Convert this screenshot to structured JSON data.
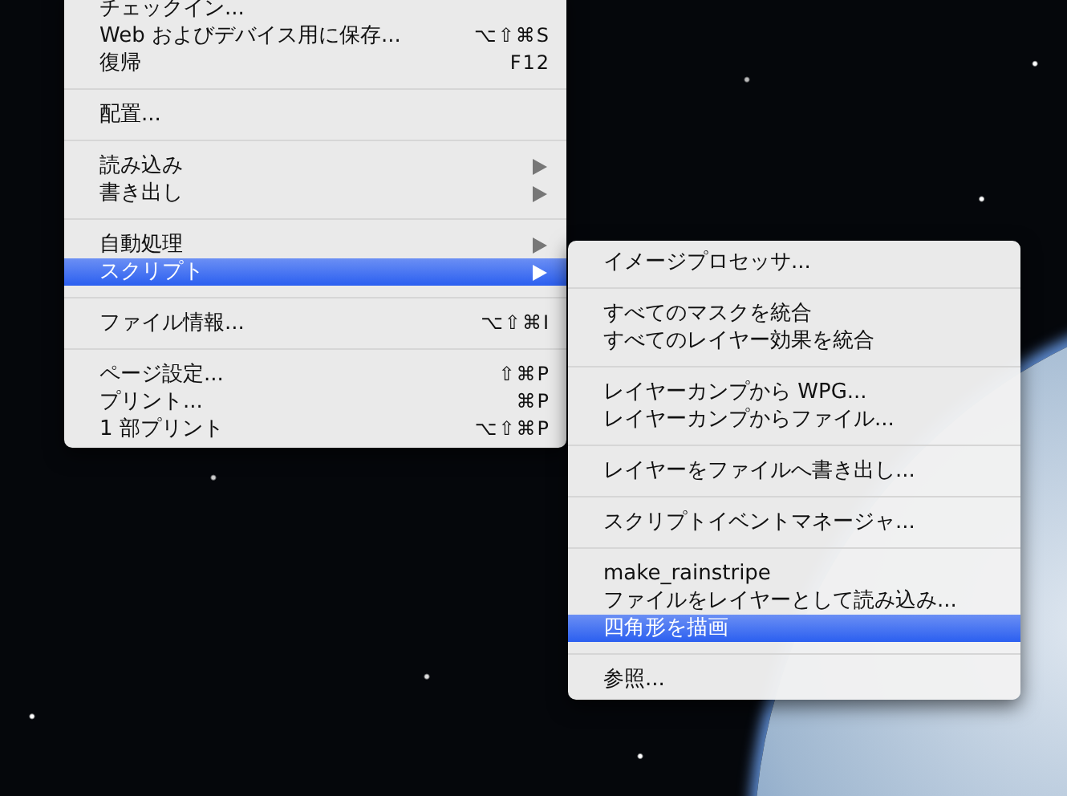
{
  "file_menu": {
    "groups": [
      [
        {
          "label": "チェックイン...",
          "selected": false
        },
        {
          "label": "Web およびデバイス用に保存...",
          "shortcut": "⌥⇧⌘S",
          "selected": false
        },
        {
          "label": "復帰",
          "shortcut": "F12",
          "selected": false
        }
      ],
      [
        {
          "label": "配置...",
          "selected": false
        }
      ],
      [
        {
          "label": "読み込み",
          "submenu": true,
          "selected": false
        },
        {
          "label": "書き出し",
          "submenu": true,
          "selected": false
        }
      ],
      [
        {
          "label": "自動処理",
          "submenu": true,
          "selected": false
        },
        {
          "label": "スクリプト",
          "submenu": true,
          "selected": true
        }
      ],
      [
        {
          "label": "ファイル情報...",
          "shortcut": "⌥⇧⌘I",
          "selected": false
        }
      ],
      [
        {
          "label": "ページ設定...",
          "shortcut": "⇧⌘P",
          "selected": false
        },
        {
          "label": "プリント...",
          "shortcut": "⌘P",
          "selected": false
        },
        {
          "label": "1 部プリント",
          "shortcut": "⌥⇧⌘P",
          "selected": false
        }
      ]
    ]
  },
  "script_submenu": {
    "groups": [
      [
        {
          "label": "イメージプロセッサ...",
          "selected": false
        }
      ],
      [
        {
          "label": "すべてのマスクを統合",
          "selected": false
        },
        {
          "label": "すべてのレイヤー効果を統合",
          "selected": false
        }
      ],
      [
        {
          "label": "レイヤーカンプから WPG...",
          "selected": false
        },
        {
          "label": "レイヤーカンプからファイル...",
          "selected": false
        }
      ],
      [
        {
          "label": "レイヤーをファイルへ書き出し...",
          "selected": false
        }
      ],
      [
        {
          "label": "スクリプトイベントマネージャ...",
          "selected": false
        }
      ],
      [
        {
          "label": "make_rainstripe",
          "selected": false
        },
        {
          "label": "ファイルをレイヤーとして読み込み...",
          "selected": false
        },
        {
          "label": "四角形を描画",
          "selected": true
        }
      ],
      [
        {
          "label": "参照...",
          "selected": false
        }
      ]
    ]
  }
}
